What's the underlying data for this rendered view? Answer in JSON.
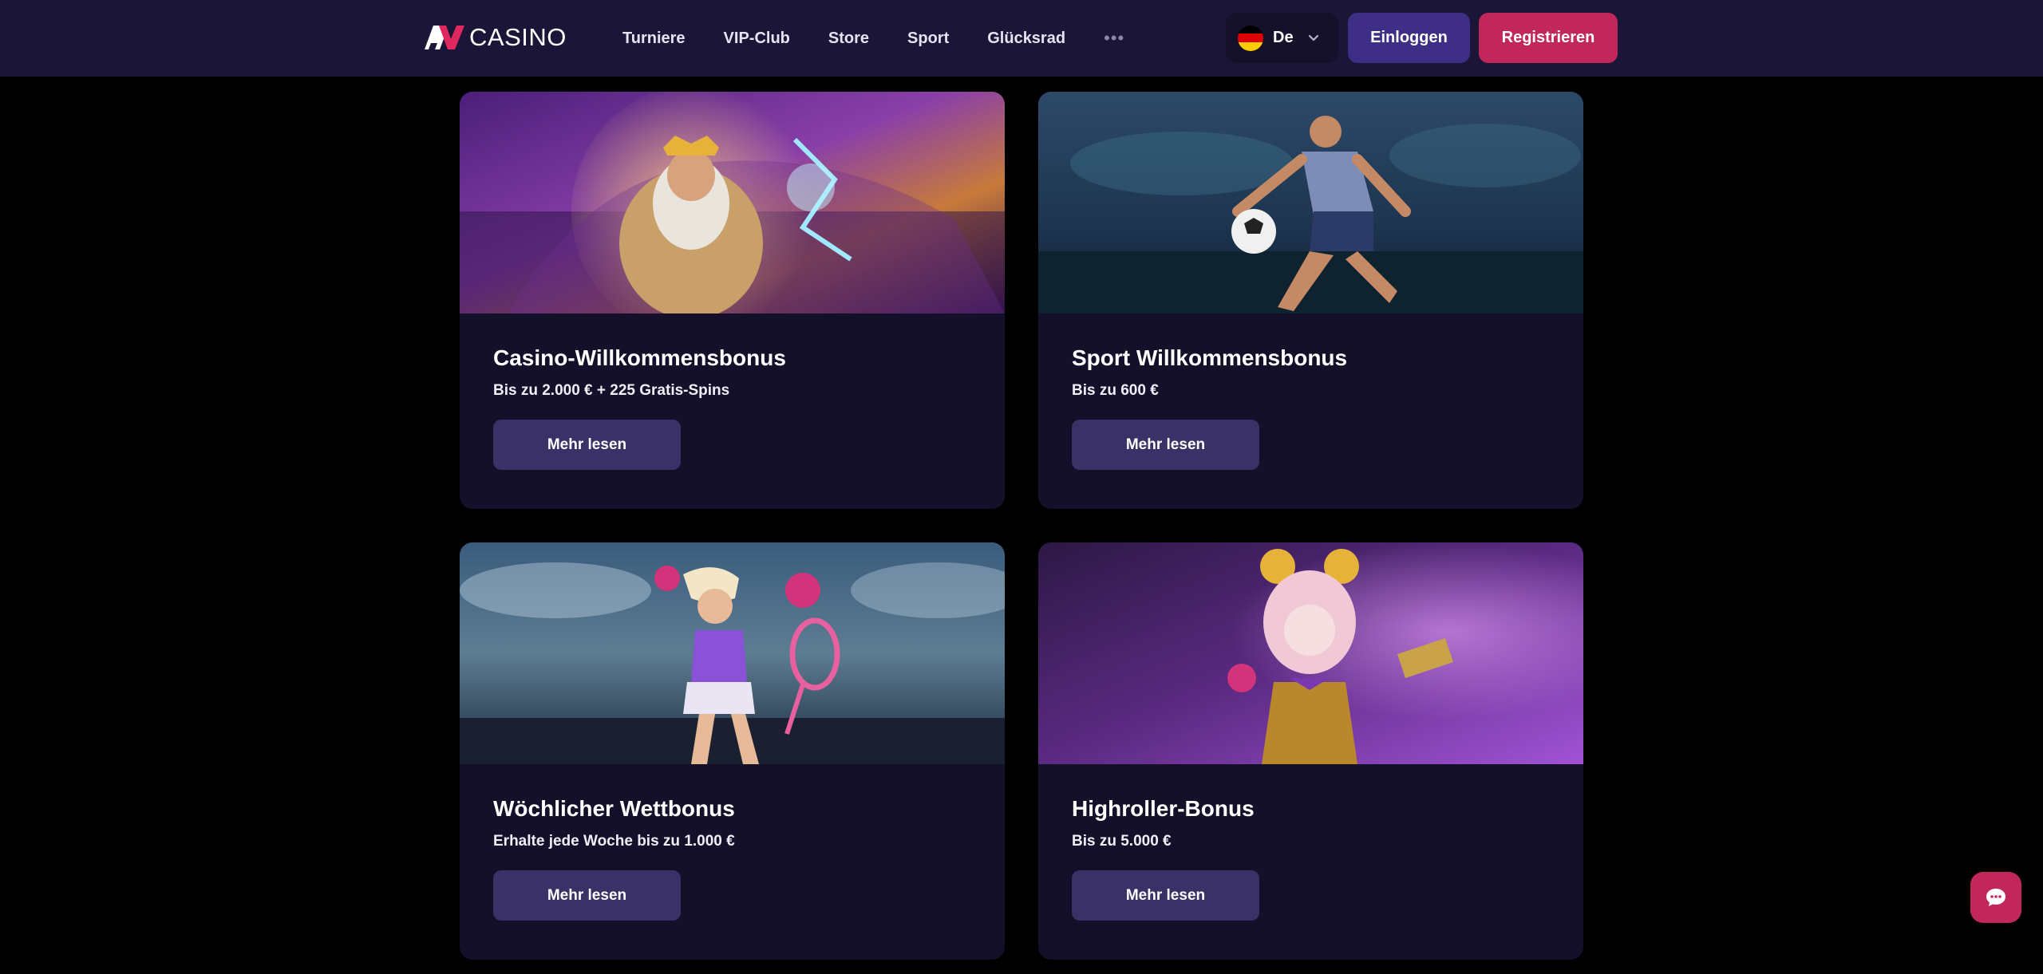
{
  "header": {
    "logo_text": "CASINO",
    "nav": [
      "Turniere",
      "VIP-Club",
      "Store",
      "Sport",
      "Glücksrad"
    ],
    "more": "•••",
    "language": "De",
    "login": "Einloggen",
    "register": "Registrieren"
  },
  "cards": [
    {
      "title": "Casino-Willkommensbonus",
      "subtitle": "Bis zu 2.000 € + 225 Gratis-Spins",
      "button": "Mehr lesen",
      "image": "zeus-casino-illustration"
    },
    {
      "title": "Sport Willkommensbonus",
      "subtitle": "Bis zu 600 €",
      "button": "Mehr lesen",
      "image": "football-player-illustration"
    },
    {
      "title": "Wöchlicher Wettbonus",
      "subtitle": "Erhalte jede Woche bis zu 1.000 €",
      "button": "Mehr lesen",
      "image": "tennis-player-illustration"
    },
    {
      "title": "Highroller-Bonus",
      "subtitle": "Bis zu 5.000 €",
      "button": "Mehr lesen",
      "image": "vip-jester-illustration"
    }
  ],
  "colors": {
    "header_bg": "#1b1537",
    "card_bg": "#141029",
    "button_bg": "#3a3166",
    "login_bg": "#3e2e86",
    "accent": "#c2275c"
  },
  "icons": {
    "chat": "chat-bubble-icon",
    "language_chevron": "chevron-down-icon",
    "flag": "germany-flag-icon"
  }
}
